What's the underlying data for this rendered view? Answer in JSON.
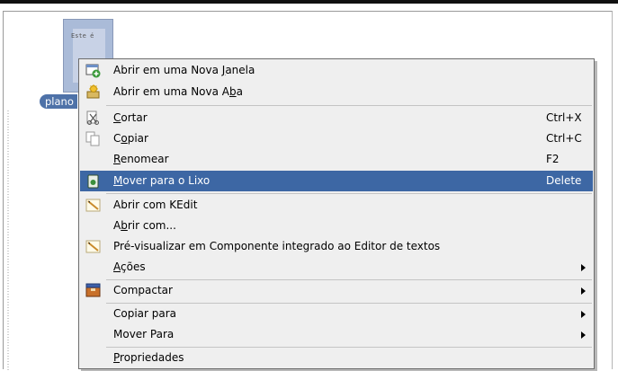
{
  "desktop": {
    "thumb_text": "Este é",
    "file_label": "plano"
  },
  "menu": {
    "items": [
      {
        "label_pre": "Abrir em uma Nova ",
        "label_u": "J",
        "label_post": "anela",
        "shortcut": "",
        "icon": "new-window-icon"
      },
      {
        "label_pre": "Abrir em uma Nova A",
        "label_u": "b",
        "label_post": "a",
        "shortcut": "",
        "icon": "new-tab-icon"
      },
      {
        "label_pre": "",
        "label_u": "C",
        "label_post": "ortar",
        "shortcut": "Ctrl+X",
        "icon": "cut-icon"
      },
      {
        "label_pre": "C",
        "label_u": "o",
        "label_post": "piar",
        "shortcut": "Ctrl+C",
        "icon": "copy-icon"
      },
      {
        "label_pre": "",
        "label_u": "R",
        "label_post": "enomear",
        "shortcut": "F2",
        "icon": ""
      },
      {
        "label_pre": "",
        "label_u": "M",
        "label_post": "over para o Lixo",
        "shortcut": "Delete",
        "icon": "trash-icon"
      },
      {
        "label_pre": "Abrir com KEdit",
        "label_u": "",
        "label_post": "",
        "shortcut": "",
        "icon": "kedit-icon"
      },
      {
        "label_pre": "A",
        "label_u": "b",
        "label_post": "rir com...",
        "shortcut": "",
        "icon": ""
      },
      {
        "label_pre": "Pré-visualizar em Componente integrado ao Editor de textos",
        "label_u": "",
        "label_post": "",
        "shortcut": "",
        "icon": "preview-editor-icon"
      },
      {
        "label_pre": "",
        "label_u": "A",
        "label_post": "ções",
        "shortcut": "",
        "icon": ""
      },
      {
        "label_pre": "Compactar",
        "label_u": "",
        "label_post": "",
        "shortcut": "",
        "icon": "compress-icon"
      },
      {
        "label_pre": "Copiar para",
        "label_u": "",
        "label_post": "",
        "shortcut": "",
        "icon": ""
      },
      {
        "label_pre": "Mover Para",
        "label_u": "",
        "label_post": "",
        "shortcut": "",
        "icon": ""
      },
      {
        "label_pre": "",
        "label_u": "P",
        "label_post": "ropriedades",
        "shortcut": "",
        "icon": ""
      }
    ]
  },
  "colors": {
    "highlight": "#3d67a4",
    "selection_label": "#4e72a8"
  }
}
